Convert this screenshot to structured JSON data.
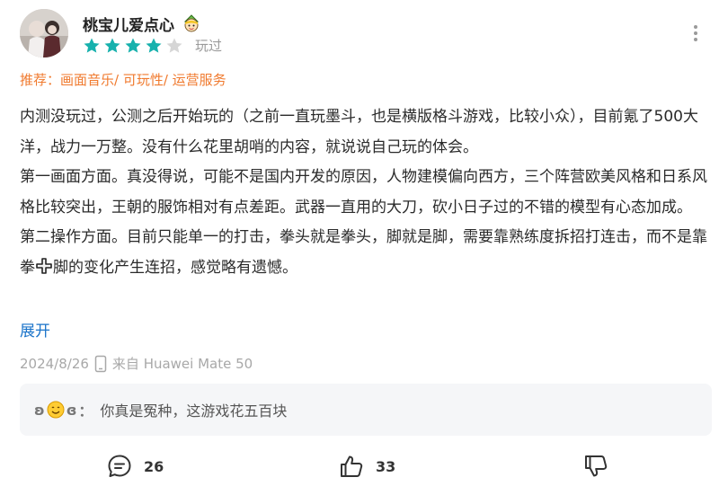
{
  "user": {
    "name": "桃宝儿爱点心",
    "rating": 4,
    "rating_max": 5,
    "status": "玩过"
  },
  "recommend": "推荐：画面音乐/ 可玩性/ 运营服务",
  "review": {
    "paragraphs": [
      "内测没玩过，公测之后开始玩的（之前一直玩墨斗，也是横版格斗游戏，比较小众），目前氪了500大洋，战力一万整。没有什么花里胡哨的内容，就说说自己玩的体会。",
      "第一画面方面。真没得说，可能不是国内开发的原因，人物建模偏向西方，三个阵营欧美风格和日系风格比较突出，王朝的服饰相对有点差距。武器一直用的大刀，砍小日子过的不错的模型有心态加成。"
    ],
    "p3_before": "第二操作方面。目前只能单一的打击，拳头就是拳头，脚就是脚，需要靠熟练度拆招打连击，而不是靠拳",
    "p3_after": "脚的变化产生连招，感觉略有遗憾。"
  },
  "expand_label": "展开",
  "meta": {
    "date": "2024/8/26",
    "device": "来自 Huawei Mate 50"
  },
  "reply": {
    "name_left": "ʚ",
    "name_right": "ɞ",
    "colon": "：",
    "text": "你真是冤种，这游戏花五百块"
  },
  "actions": {
    "comments": "26",
    "likes": "33"
  },
  "icons": {
    "avatar": "avatar-photo",
    "badge": "cartoon-character-badge",
    "more": "vertical-dots",
    "phone": "phone-outline",
    "plus": "plus-cross",
    "emoji": "smiling-face",
    "comment": "speech-bubble",
    "like": "thumbs-up",
    "dislike": "thumbs-down"
  },
  "colors": {
    "star_filled": "#17b1ad",
    "star_empty": "#d6d6d6",
    "recommend": "#f07a2e",
    "link": "#1a73c9"
  }
}
